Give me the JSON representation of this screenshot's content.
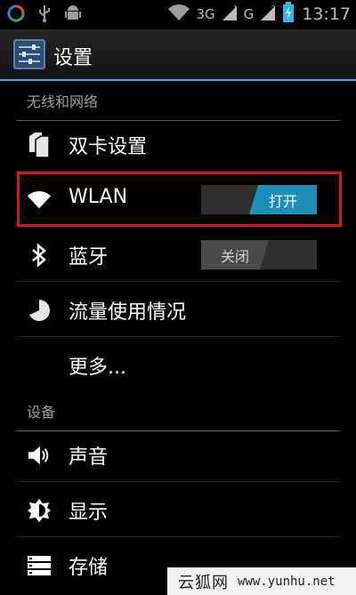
{
  "status_bar": {
    "network_3g": "3G",
    "network_g": "G",
    "time": "13:17",
    "icons": [
      "sync-icon",
      "usb-icon",
      "android-debug-icon",
      "wifi-signal-icon",
      "cell-signal-1-icon",
      "cell-signal-2-icon",
      "battery-charging-icon"
    ]
  },
  "action_bar": {
    "title": "设置",
    "icon": "settings-sliders-icon"
  },
  "sections": {
    "wireless": {
      "header": "无线和网络"
    },
    "device": {
      "header": "设备"
    }
  },
  "items": {
    "dual_sim": {
      "label": "双卡设置",
      "icon": "sim-cards-icon"
    },
    "wlan": {
      "label": "WLAN",
      "icon": "wifi-icon",
      "toggle_label": "打开",
      "toggle_state": "on"
    },
    "bluetooth": {
      "label": "蓝牙",
      "icon": "bluetooth-icon",
      "toggle_label": "关闭",
      "toggle_state": "off"
    },
    "data_usage": {
      "label": "流量使用情况",
      "icon": "data-usage-icon"
    },
    "more": {
      "label": "更多..."
    },
    "sound": {
      "label": "声音",
      "icon": "speaker-icon"
    },
    "display": {
      "label": "显示",
      "icon": "brightness-icon"
    },
    "storage": {
      "label": "存储",
      "icon": "storage-icon"
    }
  },
  "watermark": {
    "brand": "云狐网",
    "url": "www.yunhu.net"
  },
  "colors": {
    "accent": "#33b5e5",
    "toggle_on": "#1e8fb8",
    "highlight": "#d01b1b"
  }
}
